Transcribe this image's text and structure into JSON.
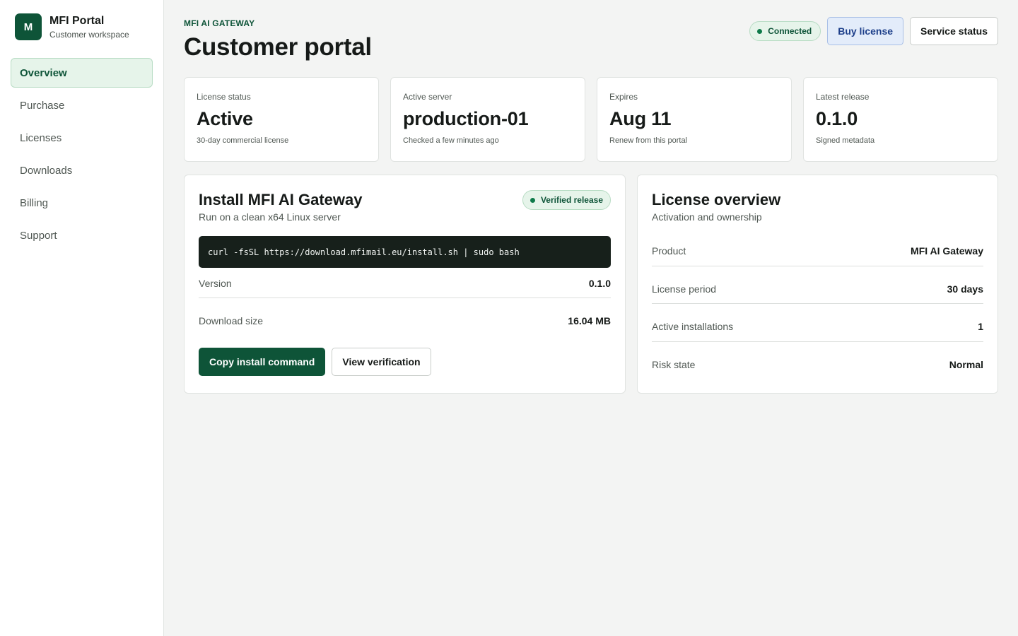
{
  "sidebar": {
    "logo_letter": "M",
    "brand_name": "MFI Portal",
    "brand_sub": "Customer workspace",
    "items": [
      {
        "label": "Overview",
        "active": true
      },
      {
        "label": "Purchase"
      },
      {
        "label": "Licenses"
      },
      {
        "label": "Downloads"
      },
      {
        "label": "Billing"
      },
      {
        "label": "Support"
      }
    ]
  },
  "header": {
    "eyebrow": "MFI AI GATEWAY",
    "title": "Customer portal",
    "connection_label": "Connected",
    "buy_label": "Buy license",
    "service_label": "Service status"
  },
  "stats": [
    {
      "label": "License status",
      "value": "Active",
      "sub": "30-day commercial license"
    },
    {
      "label": "Active server",
      "value": "production-01",
      "sub": "Checked a few minutes ago"
    },
    {
      "label": "Expires",
      "value": "Aug 11",
      "sub": "Renew from this portal"
    },
    {
      "label": "Latest release",
      "value": "0.1.0",
      "sub": "Signed metadata"
    }
  ],
  "install": {
    "title": "Install MFI AI Gateway",
    "subtitle": "Run on a clean x64 Linux server",
    "badge": "Verified release",
    "command": "curl -fsSL https://download.mfimail.eu/install.sh | sudo bash",
    "rows": [
      {
        "key": "Version",
        "value": "0.1.0"
      },
      {
        "key": "Download size",
        "value": "16.04 MB"
      }
    ],
    "copy_label": "Copy install command",
    "verify_label": "View verification"
  },
  "license": {
    "title": "License overview",
    "subtitle": "Activation and ownership",
    "rows": [
      {
        "key": "Product",
        "value": "MFI AI Gateway"
      },
      {
        "key": "License period",
        "value": "30 days"
      },
      {
        "key": "Active installations",
        "value": "1"
      },
      {
        "key": "Risk state",
        "value": "Normal"
      }
    ]
  },
  "colors": {
    "accent": "#0e5438",
    "accent_soft": "#e6f4ea",
    "buy_accent": "#1d3f8a",
    "background": "#f3f4f3"
  }
}
